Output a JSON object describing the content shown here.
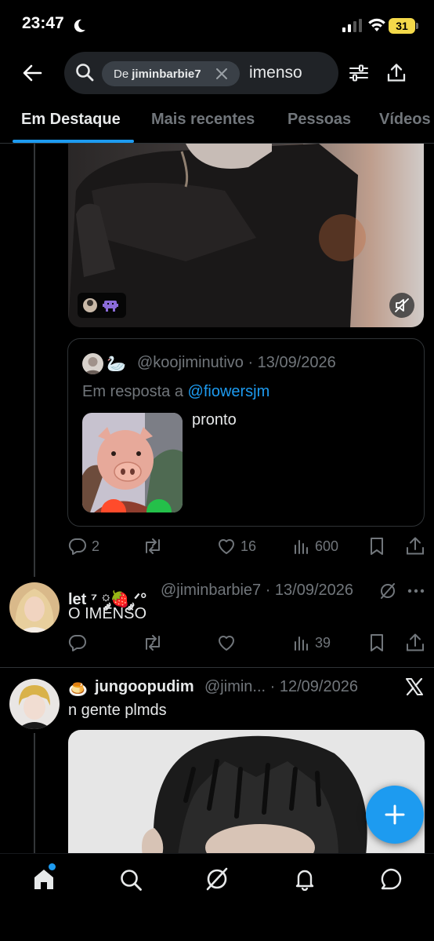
{
  "status_bar": {
    "time": "23:47",
    "battery": "31"
  },
  "search": {
    "chip_prefix": "De",
    "chip_user": "jiminbarbie7",
    "query": "imenso"
  },
  "tabs": [
    {
      "label": "Em Destaque"
    },
    {
      "label": "Mais recentes"
    },
    {
      "label": "Pessoas"
    },
    {
      "label": "Vídeos"
    }
  ],
  "quoted_post": {
    "handle_date": "@koojiminutivo · 13/09/2026",
    "reply_prefix": "Em resposta a ",
    "reply_to": "@fiowersjm",
    "text": "pronto"
  },
  "post1_actions": {
    "replies": "2",
    "reposts": "",
    "likes": "16",
    "views": "600"
  },
  "post2": {
    "name": "let ⁷ ༘🍓 ༘ᐟ°",
    "meta": "@jiminbarbie7 · 13/09/2026",
    "text": "O IMENSO",
    "views": "39"
  },
  "post3": {
    "emoji": "🍮",
    "name": "jungoopudim",
    "meta": "@jimin... · 12/09/2026",
    "text": "n gente plmds"
  },
  "colors": {
    "accent": "#1d9bf0",
    "background": "#000000",
    "muted": "#71767b",
    "text": "#e7e9ea"
  }
}
